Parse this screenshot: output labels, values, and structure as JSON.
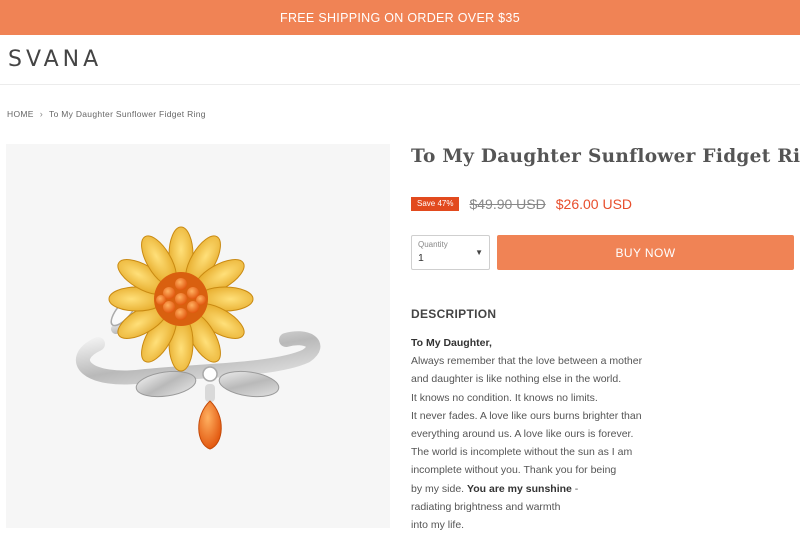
{
  "announcement": "FREE SHIPPING ON ORDER OVER $35",
  "brand": "SVANA",
  "breadcrumb": {
    "home": "HOME",
    "separator": "›",
    "current": "To My Daughter Sunflower Fidget Ring"
  },
  "product": {
    "title": "To My Daughter Sunflower Fidget Ring",
    "badge": "Save 47%",
    "compare_price": "$49.90 USD",
    "price": "$26.00 USD",
    "quantity_label": "Quantity",
    "quantity_value": "1",
    "buy_label": "BUY NOW",
    "image_icon": "sunflower-ring-image"
  },
  "description": {
    "heading": "DESCRIPTION",
    "greeting": "To My Daughter,",
    "lines": [
      "Always remember that the love between a mother",
      "and daughter is like nothing else in the world.",
      "It knows no condition. It knows no limits.",
      "It never fades. A love like ours burns brighter than",
      "everything around us. A love like ours is forever.",
      "The world is incomplete without the sun as I am",
      "incomplete without you. Thank you for being"
    ],
    "line8_pre": "by my side. ",
    "line8_bold": "You are my sunshine",
    "line8_post": " -",
    "line9": "radiating brightness and warmth",
    "line10": "into my life."
  },
  "colors": {
    "accent": "#f08355",
    "sale_badge": "#e24a1e",
    "sale_price": "#e84e2c"
  }
}
